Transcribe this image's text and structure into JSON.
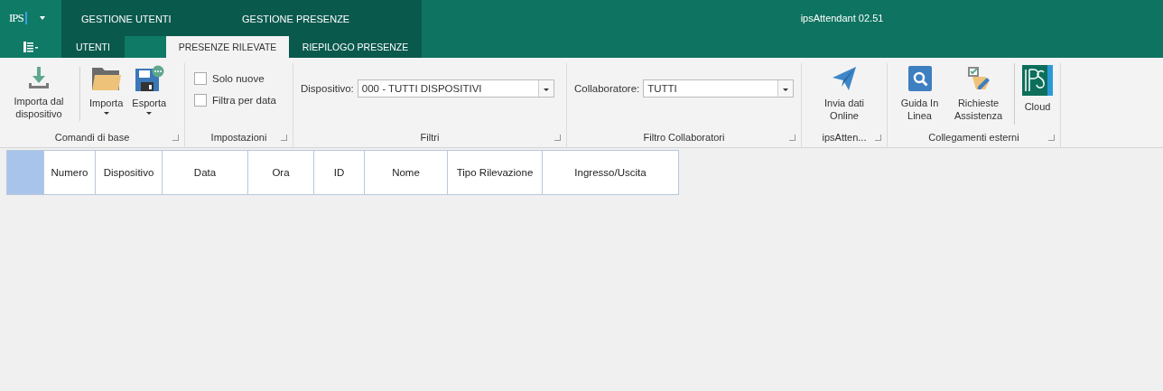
{
  "title_bar": {
    "logo": "IPS",
    "context_tabs": [
      "GESTIONE UTENTI",
      "GESTIONE PRESENZE"
    ],
    "app_version": "ipsAttendant 02.51"
  },
  "tabs": [
    {
      "label": "UTENTI",
      "selected": false
    },
    {
      "label": "PRESENZE RILEVATE",
      "selected": true
    },
    {
      "label": "RIEPILOGO PRESENZE",
      "selected": false
    }
  ],
  "ribbon": {
    "comandi_di_base": {
      "label": "Comandi di base",
      "buttons": [
        {
          "label": "Importa dal dispositivo",
          "dropdown": false
        },
        {
          "label": "Importa",
          "dropdown": true
        },
        {
          "label": "Esporta",
          "dropdown": true
        }
      ]
    },
    "impostazioni": {
      "label": "Impostazioni",
      "checkboxes": [
        {
          "label": "Solo nuove",
          "checked": false
        },
        {
          "label": "Filtra per data",
          "checked": false
        }
      ]
    },
    "filtri": {
      "label": "Filtri",
      "field_label": "Dispositivo:",
      "value": "000 - TUTTI DISPOSITIVI"
    },
    "filtro_collaboratori": {
      "label": "Filtro Collaboratori",
      "field_label": "Collaboratore:",
      "value": "TUTTI"
    },
    "ipsattendant": {
      "label": "ipsAtten...",
      "button": "Invia dati Online"
    },
    "collegamenti_esterni": {
      "label": "Collegamenti esterni",
      "buttons": [
        "Guida In Linea",
        "Richieste Assistenza",
        "Cloud"
      ]
    }
  },
  "table": {
    "columns": [
      "Numero",
      "Dispositivo",
      "Data",
      "Ora",
      "ID",
      "Nome",
      "Tipo Rilevazione",
      "Ingresso/Uscita"
    ]
  }
}
